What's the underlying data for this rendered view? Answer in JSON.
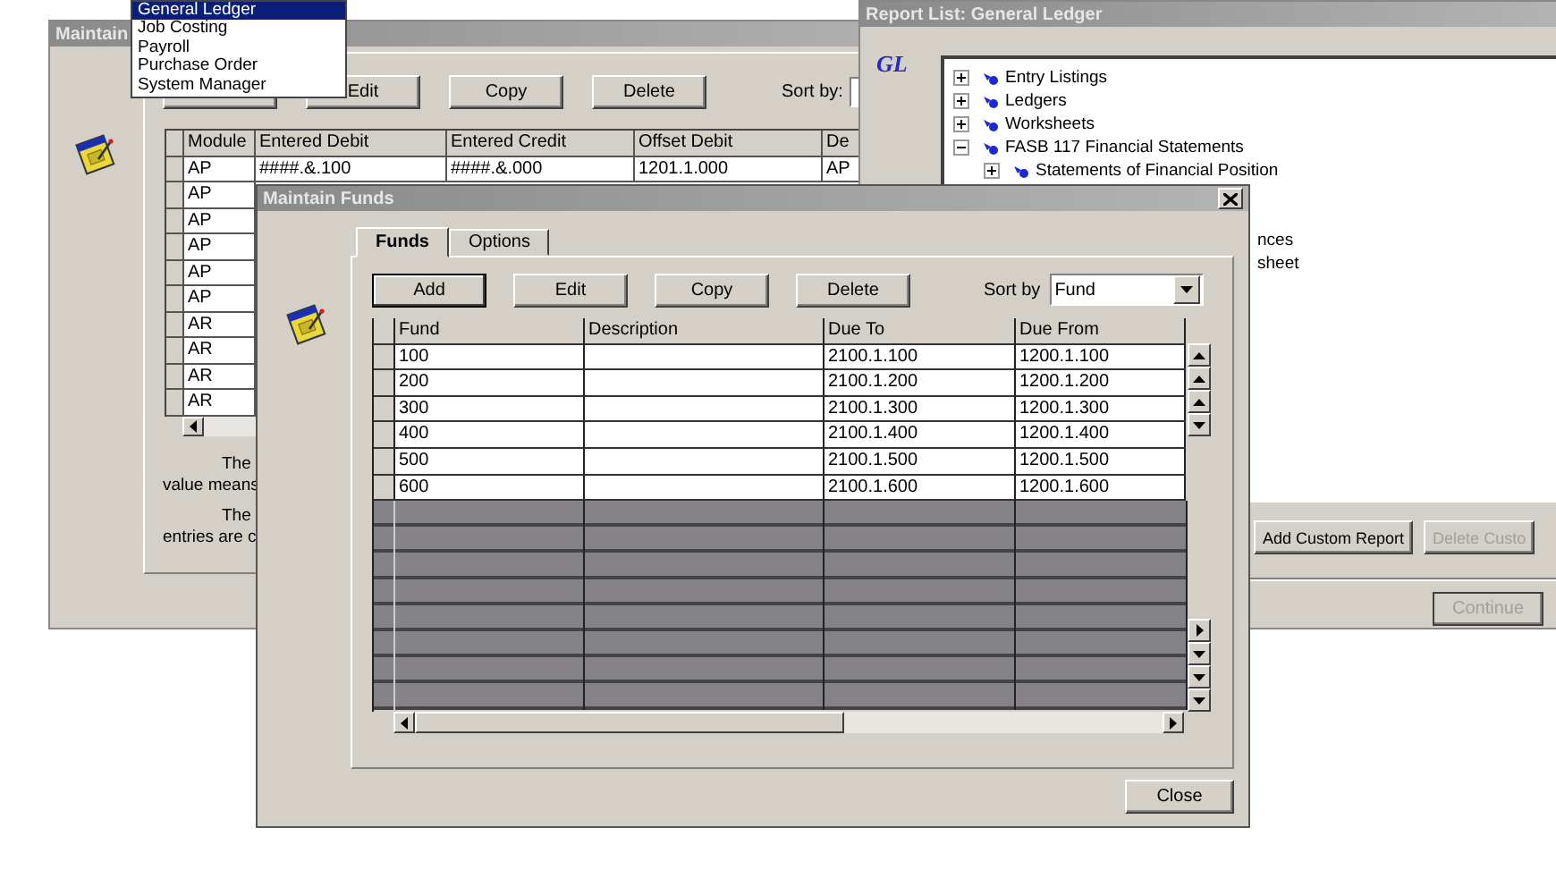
{
  "menu": {
    "items": [
      {
        "label": "General Ledger",
        "selected": true
      },
      {
        "label": "Job Costing",
        "selected": false
      },
      {
        "label": "Payroll",
        "selected": false
      },
      {
        "label": "Purchase Order",
        "selected": false
      },
      {
        "label": "System Manager",
        "selected": false
      }
    ]
  },
  "back_window": {
    "title": "Maintain",
    "buttons": [
      "Edit",
      "Copy",
      "Delete"
    ],
    "sort_label": "Sort by:",
    "columns": [
      "Module",
      "Entered Debit",
      "Entered Credit",
      "Offset Debit",
      "De"
    ],
    "first_row": [
      "AP",
      "####.&.100",
      "####.&.000",
      "1201.1.000",
      "AP"
    ],
    "module_cells": [
      "AP",
      "AP",
      "AP",
      "AP",
      "AP",
      "AR",
      "AR",
      "AR",
      "AR"
    ],
    "notes": [
      {
        "lines": [
          "The",
          "value means"
        ]
      },
      {
        "lines": [
          "The",
          "entries are c"
        ]
      }
    ]
  },
  "report_window": {
    "title": "Report List: General Ledger",
    "logo": "GL",
    "tree": [
      {
        "label": "Entry Listings",
        "expanded": false
      },
      {
        "label": "Ledgers",
        "expanded": false
      },
      {
        "label": "Worksheets",
        "expanded": false
      },
      {
        "label": "FASB 117 Financial Statements",
        "expanded": true,
        "children": [
          {
            "label": "Statements of Financial Position",
            "expanded": false
          }
        ]
      }
    ],
    "fragments": [
      "nces",
      "sheet"
    ],
    "buttons": [
      {
        "label": "Add Custom Report",
        "disabled": false
      },
      {
        "label": "Delete Custo",
        "disabled": true
      }
    ],
    "continue": {
      "label": "Continue",
      "disabled": true
    }
  },
  "funds_window": {
    "title": "Maintain Funds",
    "tabs": [
      {
        "label": "Funds",
        "selected": true
      },
      {
        "label": "Options",
        "selected": false
      }
    ],
    "buttons": [
      {
        "label": "Add",
        "default": true
      },
      {
        "label": "Edit",
        "default": false
      },
      {
        "label": "Copy",
        "default": false
      },
      {
        "label": "Delete",
        "default": false
      }
    ],
    "sort_label": "Sort by",
    "sort_value": "Fund",
    "columns": [
      "Fund",
      "Description",
      "Due To",
      "Due From"
    ],
    "rows": [
      [
        "100",
        "",
        "2100.1.100",
        "1200.1.100"
      ],
      [
        "200",
        "",
        "2100.1.200",
        "1200.1.200"
      ],
      [
        "300",
        "",
        "2100.1.300",
        "1200.1.300"
      ],
      [
        "400",
        "",
        "2100.1.400",
        "1200.1.400"
      ],
      [
        "500",
        "",
        "2100.1.500",
        "1200.1.500"
      ],
      [
        "600",
        "",
        "2100.1.600",
        "1200.1.600"
      ]
    ],
    "close": "Close"
  }
}
